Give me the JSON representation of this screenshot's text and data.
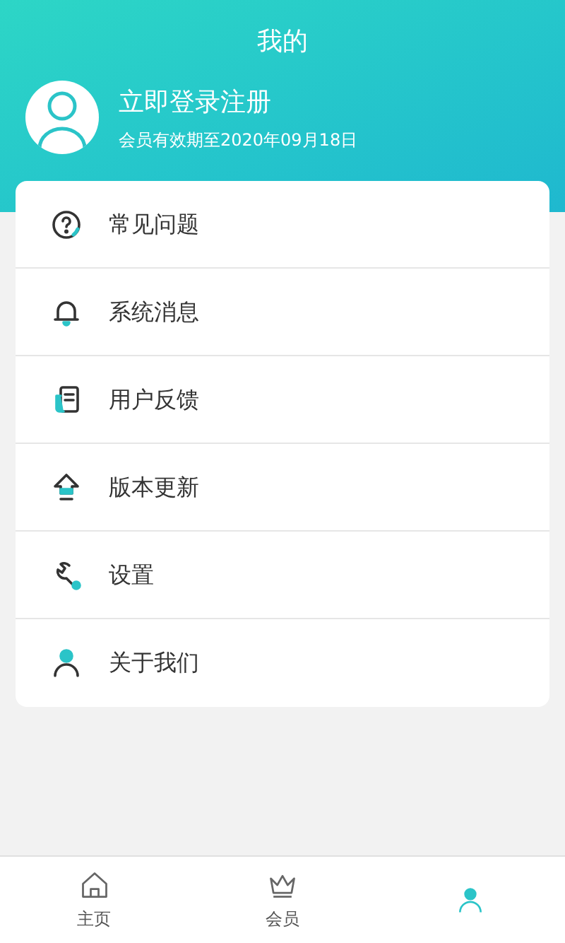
{
  "header": {
    "title": "我的"
  },
  "profile": {
    "name": "立即登录注册",
    "membership": "会员有效期至2020年09月18日"
  },
  "menu": [
    {
      "kind": "help",
      "label": "常见问题"
    },
    {
      "kind": "bell",
      "label": "系统消息"
    },
    {
      "kind": "feedback",
      "label": "用户反馈"
    },
    {
      "kind": "update",
      "label": "版本更新"
    },
    {
      "kind": "settings",
      "label": "设置"
    },
    {
      "kind": "about",
      "label": "关于我们"
    }
  ],
  "tabbar": [
    {
      "kind": "home",
      "label": "主页",
      "selected": false
    },
    {
      "kind": "crown",
      "label": "会员",
      "selected": false
    },
    {
      "kind": "person",
      "selected": true
    }
  ]
}
